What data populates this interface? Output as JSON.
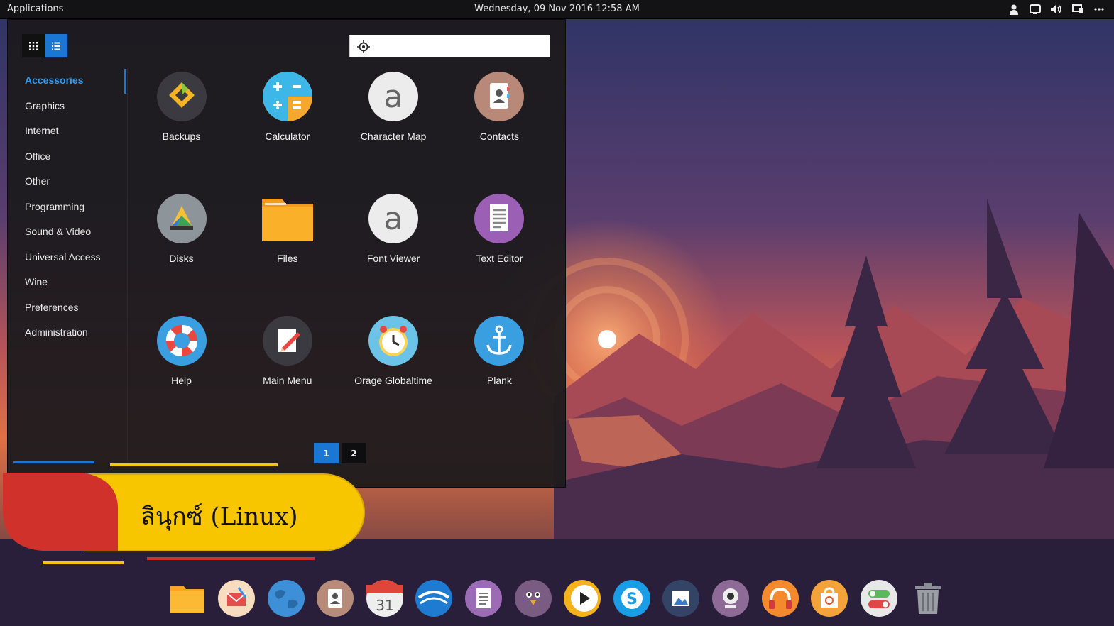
{
  "topbar": {
    "applications_label": "Applications",
    "datetime": "Wednesday, 09 Nov 2016 12:58 AM",
    "tray_icons": [
      "user-icon",
      "display-icon",
      "volume-icon",
      "screen-icon",
      "more-icon"
    ]
  },
  "menu": {
    "view_modes": [
      "grid-view-icon",
      "list-view-icon"
    ],
    "active_view": "list",
    "search": {
      "value": "",
      "placeholder": ""
    },
    "categories": [
      {
        "label": "Accessories",
        "active": true
      },
      {
        "label": "Graphics"
      },
      {
        "label": "Internet"
      },
      {
        "label": "Office"
      },
      {
        "label": "Other"
      },
      {
        "label": "Programming"
      },
      {
        "label": "Sound & Video"
      },
      {
        "label": "Universal Access"
      },
      {
        "label": "Wine"
      },
      {
        "label": "Preferences"
      },
      {
        "label": "Administration"
      }
    ],
    "apps": [
      {
        "label": "Backups",
        "icon": "backups-icon"
      },
      {
        "label": "Calculator",
        "icon": "calculator-icon"
      },
      {
        "label": "Character Map",
        "icon": "character-map-icon"
      },
      {
        "label": "Contacts",
        "icon": "contacts-icon"
      },
      {
        "label": "Disks",
        "icon": "disks-icon"
      },
      {
        "label": "Files",
        "icon": "folder-icon"
      },
      {
        "label": "Font Viewer",
        "icon": "font-viewer-icon"
      },
      {
        "label": "Text Editor",
        "icon": "text-editor-icon"
      },
      {
        "label": "Help",
        "icon": "help-lifebuoy-icon"
      },
      {
        "label": "Main Menu",
        "icon": "main-menu-icon"
      },
      {
        "label": "Orage Globaltime",
        "icon": "clock-icon"
      },
      {
        "label": "Plank",
        "icon": "anchor-icon"
      }
    ],
    "pages": [
      "1",
      "2"
    ],
    "current_page": "1"
  },
  "banner": {
    "text": "ลินุกซ์ (Linux)"
  },
  "dock": {
    "items": [
      "folder-icon",
      "mail-icon",
      "globe-icon",
      "contacts-icon",
      "calendar-icon",
      "earth-icon",
      "notes-icon",
      "pidgin-icon",
      "media-player-icon",
      "skype-icon",
      "image-viewer-icon",
      "webcam-icon",
      "headphones-icon",
      "software-center-icon",
      "settings-toggle-icon",
      "trash-icon"
    ],
    "calendar_day": "31"
  },
  "colors": {
    "accent": "#1a78d4",
    "banner_yellow": "#f7c600",
    "banner_red": "#d1312b"
  }
}
